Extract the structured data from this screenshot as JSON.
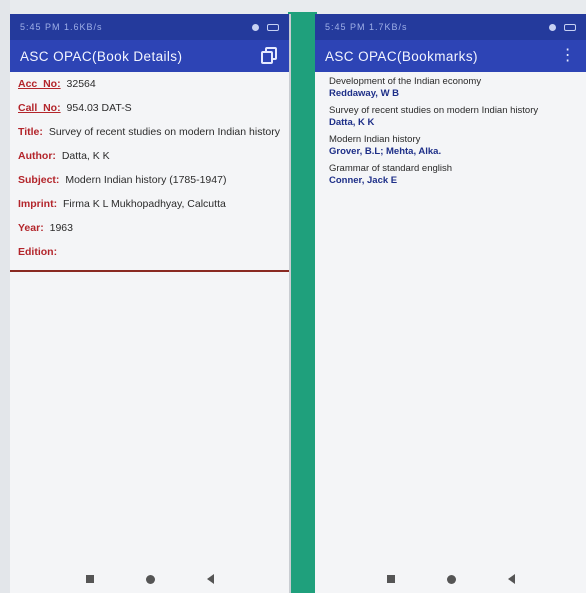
{
  "left_screen": {
    "status_time": "5:45 PM  1.6KB/s",
    "app_title": "ASC OPAC(Book Details)",
    "details": [
      {
        "label": "Acc_No:",
        "value": "32564"
      },
      {
        "label": "Call_No:",
        "value": "954.03  DAT-S"
      },
      {
        "label": "Title:",
        "value": "Survey of recent studies on modern Indian history"
      },
      {
        "label": "Author:",
        "value": "Datta, K K"
      },
      {
        "label": "Subject:",
        "value": "Modern Indian history (1785-1947)"
      },
      {
        "label": "Imprint:",
        "value": "Firma K L Mukhopadhyay, Calcutta"
      },
      {
        "label": "Year:",
        "value": "1963"
      },
      {
        "label": "Edition:",
        "value": ""
      }
    ]
  },
  "right_screen": {
    "status_time": "5:45 PM  1.7KB/s",
    "app_title": "ASC OPAC(Bookmarks)",
    "bookmarks": [
      {
        "title": "Development of the Indian economy",
        "author": "Reddaway, W B"
      },
      {
        "title": "Survey of recent studies on modern Indian history",
        "author": "Datta, K K"
      },
      {
        "title": "Modern Indian history",
        "author": "Grover, B.L; Mehta, Alka."
      },
      {
        "title": "Grammar of standard english",
        "author": "Conner, Jack E"
      }
    ]
  },
  "colors": {
    "statusbar": "#243a9c",
    "appbar": "#2d44b5",
    "label_red": "#b3252b",
    "author_blue": "#1e2f88",
    "divider_green": "#1fa07c"
  },
  "icons": {
    "copy": "copy-icon",
    "overflow": "overflow-menu-icon",
    "nav": [
      "recents-nav-icon",
      "home-nav-icon",
      "back-nav-icon"
    ]
  }
}
